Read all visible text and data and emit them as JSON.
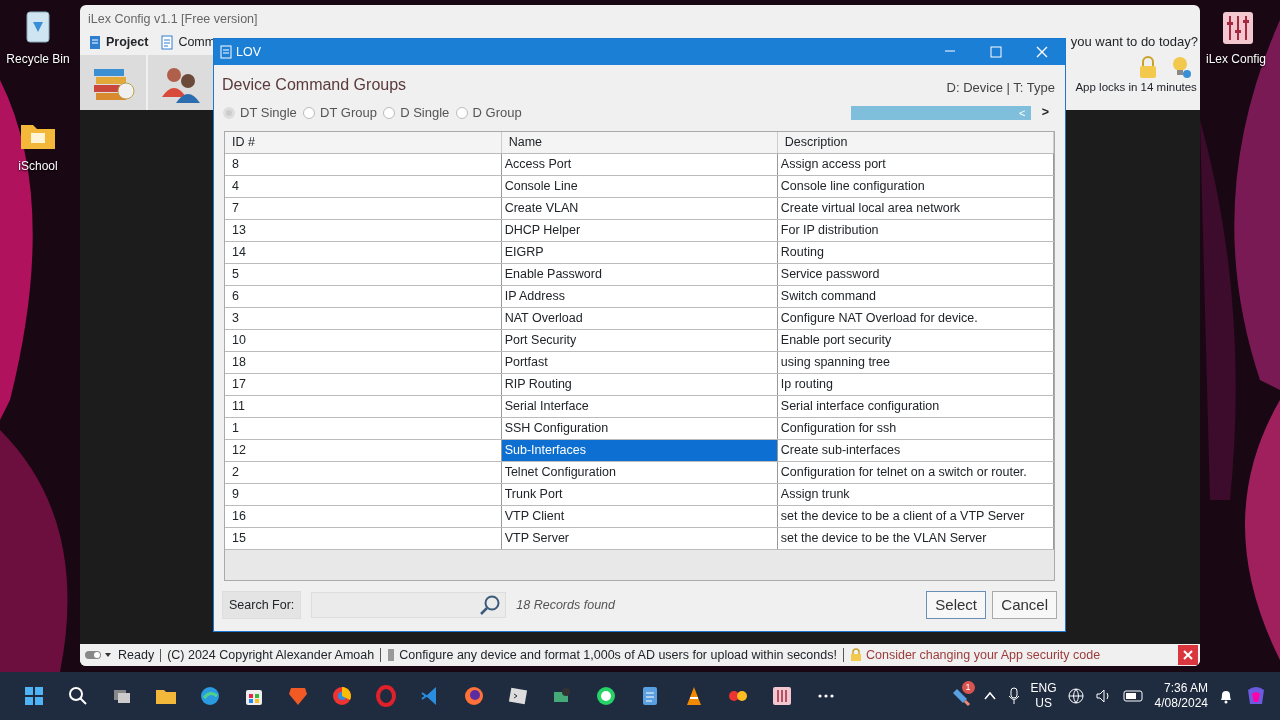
{
  "desktop_icons": [
    {
      "label": "Recycle Bin"
    },
    {
      "label": "iSchool"
    },
    {
      "label": "iLex Config"
    }
  ],
  "app_window": {
    "title": "iLex Config v1.1 [Free version]",
    "menu": [
      "Project",
      "Comm"
    ],
    "prompt": "you want to do today?",
    "lock_notice": "App locks in 14 minutes",
    "status_bar": [
      "Ready",
      "(C) 2024 Copyright Alexander Amoah",
      "Configure any device and format 1,000s of AD users for upload within seconds!",
      "Consider changing your App security code"
    ]
  },
  "dialog": {
    "title": "LOV",
    "heading": "Device Command Groups",
    "legend": "D: Device | T: Type",
    "radios": [
      {
        "label": "DT Single",
        "selected": true
      },
      {
        "label": "DT Group",
        "selected": false
      },
      {
        "label": "D Single",
        "selected": false
      },
      {
        "label": "D Group",
        "selected": false
      }
    ],
    "pager": {
      "prev": "<",
      "next": ">"
    },
    "table": {
      "columns": [
        "ID #",
        "Name",
        "Description"
      ],
      "rows": [
        {
          "cells": [
            "8",
            "Access Port",
            "Assign access port"
          ],
          "selected": false
        },
        {
          "cells": [
            "4",
            "Console Line",
            "Console line configuration"
          ],
          "selected": false
        },
        {
          "cells": [
            "7",
            "Create VLAN",
            "Create virtual local area network"
          ],
          "selected": false
        },
        {
          "cells": [
            "13",
            "DHCP Helper",
            "For IP distribution"
          ],
          "selected": false
        },
        {
          "cells": [
            "14",
            "EIGRP",
            "Routing"
          ],
          "selected": false
        },
        {
          "cells": [
            "5",
            "Enable Password",
            "Service password"
          ],
          "selected": false
        },
        {
          "cells": [
            "6",
            "IP Address",
            "Switch command"
          ],
          "selected": false
        },
        {
          "cells": [
            "3",
            "NAT Overload",
            "Configure NAT Overload for device."
          ],
          "selected": false
        },
        {
          "cells": [
            "10",
            "Port Security",
            "Enable port security"
          ],
          "selected": false
        },
        {
          "cells": [
            "18",
            "Portfast",
            "using spanning tree"
          ],
          "selected": false
        },
        {
          "cells": [
            "17",
            "RIP Routing",
            "Ip routing"
          ],
          "selected": false
        },
        {
          "cells": [
            "11",
            "Serial Interface",
            "Serial interface configuration"
          ],
          "selected": false
        },
        {
          "cells": [
            "1",
            "SSH Configuration",
            "Configuration for ssh"
          ],
          "selected": false
        },
        {
          "cells": [
            "12",
            "Sub-Interfaces",
            "Create sub-interfaces"
          ],
          "selected": true
        },
        {
          "cells": [
            "2",
            "Telnet Configuration",
            "Configuration for telnet on a switch or router."
          ],
          "selected": false
        },
        {
          "cells": [
            "9",
            "Trunk Port",
            "Assign trunk"
          ],
          "selected": false
        },
        {
          "cells": [
            "16",
            "VTP Client",
            "set the device to be a client of a VTP Server"
          ],
          "selected": false
        },
        {
          "cells": [
            "15",
            "VTP Server",
            "set the device to be the VLAN Server"
          ],
          "selected": false
        }
      ]
    },
    "search_label": "Search For:",
    "records": "18 Records found",
    "buttons": [
      "Select",
      "Cancel"
    ]
  },
  "taskbar": {
    "badge": "1",
    "language": "ENG",
    "region": "US",
    "time": "7:36 AM",
    "date": "4/08/2024"
  }
}
